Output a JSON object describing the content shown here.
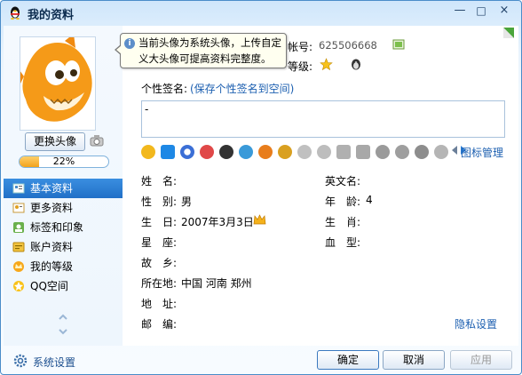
{
  "window": {
    "title": "我的资料",
    "icon": "qq-penguin-icon"
  },
  "window_buttons": [
    "—",
    "□",
    "×"
  ],
  "avatar": {
    "change_button": "更换头像",
    "progress_percent": 22,
    "progress_label": "22%"
  },
  "tooltip": {
    "text": "当前头像为系统头像，上传自定义大头像可提高资料完整度。"
  },
  "sidebar": {
    "items": [
      {
        "label": "基本资料",
        "icon": "profile-card-icon",
        "active": true
      },
      {
        "label": "更多资料",
        "icon": "more-info-icon",
        "active": false
      },
      {
        "label": "标签和印象",
        "icon": "tag-icon",
        "active": false
      },
      {
        "label": "账户资料",
        "icon": "account-icon",
        "active": false
      },
      {
        "label": "我的等级",
        "icon": "level-crown-icon",
        "active": false
      },
      {
        "label": "QQ空间",
        "icon": "qzone-icon",
        "active": false
      }
    ]
  },
  "header": {
    "account_label": "帐号:",
    "account_value": "625506668",
    "level_label": "等级:"
  },
  "signature": {
    "label": "个性签名:",
    "save_link": "(保存个性签名到空间)",
    "value": "-"
  },
  "icon_manage_link": "图标管理",
  "fields": {
    "name_label": "姓　名:",
    "name_value": "",
    "english_name_label": "英文名:",
    "english_name_value": "",
    "gender_label": "性　别:",
    "gender_value": "男",
    "age_label": "年　龄:",
    "age_value": "4",
    "birthday_label": "生　日:",
    "birthday_value": "2007年3月3日",
    "zodiac_label": "生　肖:",
    "zodiac_value": "",
    "constellation_label": "星　座:",
    "constellation_value": "",
    "blood_label": "血　型:",
    "blood_value": "",
    "hometown_label": "故　乡:",
    "hometown_value": "",
    "location_label": "所在地:",
    "location_value": "中国  河南  郑州",
    "address_label": "地　址:",
    "address_value": "",
    "postal_label": "邮　编:",
    "postal_value": ""
  },
  "privacy_link": "隐私设置",
  "footer": {
    "settings_label": "系统设置",
    "ok_button": "确定",
    "cancel_button": "取消",
    "apply_button": "应用"
  },
  "colors": {
    "accent": "#2170c7",
    "link": "#1c5fb0",
    "border": "#4a8cc9"
  }
}
